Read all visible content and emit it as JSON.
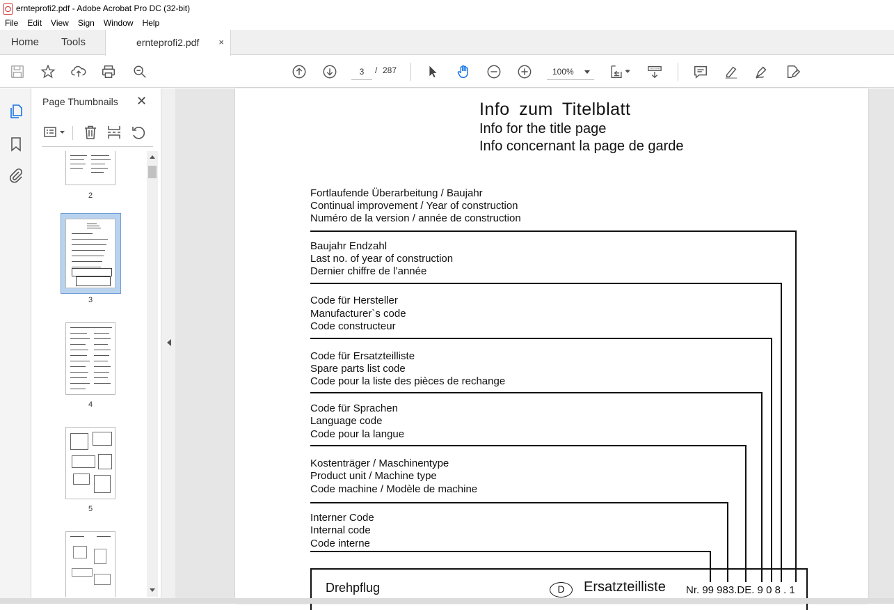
{
  "window": {
    "title": "ernteprofi2.pdf - Adobe Acrobat Pro DC (32-bit)"
  },
  "menu": [
    "File",
    "Edit",
    "View",
    "Sign",
    "Window",
    "Help"
  ],
  "tabs": {
    "home": "Home",
    "tools": "Tools",
    "document": "ernteprofi2.pdf",
    "close": "×"
  },
  "toolbar": {
    "current_page": "3",
    "page_separator": "/",
    "total_pages": "287",
    "zoom": "100%",
    "icons": [
      "save-icon",
      "star-icon",
      "upload-icon",
      "print-icon",
      "search-zoom-icon",
      "page-up-icon",
      "page-down-icon",
      "select-arrow-icon",
      "hand-icon",
      "zoom-out-icon",
      "zoom-in-icon",
      "fit-page-icon",
      "scroll-mode-icon",
      "comment-icon",
      "highlight-icon",
      "sign-icon",
      "edit-icon"
    ]
  },
  "sidebar": {
    "title": "Page Thumbnails",
    "close": "✕",
    "thumbnails": [
      {
        "num": "2"
      },
      {
        "num": "3",
        "selected": true
      },
      {
        "num": "4"
      },
      {
        "num": "5"
      }
    ]
  },
  "document": {
    "title_de": "Info  zum  Titelblatt",
    "title_en": "Info for the title page",
    "title_fr": "Info concernant la page de garde",
    "blocks": [
      [
        "Fortlaufende Überarbeitung / Baujahr",
        "Continual improvement / Year of construction",
        "Numéro de la version / année de construction"
      ],
      [
        "Baujahr Endzahl",
        "Last no. of year of construction",
        "Dernier chiffre de l’année"
      ],
      [
        "Code für Hersteller",
        "Manufacturer`s  code",
        "Code constructeur"
      ],
      [
        "Code für Ersatzteilliste",
        "Spare parts list code",
        "Code pour la liste des pièces de rechange"
      ],
      [
        "Code für Sprachen",
        "Language code",
        "Code pour la langue"
      ],
      [
        "Kostenträger / Maschinentype",
        "Product unit / Machine type",
        "Code machine / Modèle de machine"
      ],
      [
        "Interner Code",
        "Internal code",
        "Code interne"
      ]
    ],
    "box": {
      "left_label": "Drehpflug",
      "lang_badge": "D",
      "center_label": "Ersatzteilliste",
      "number": "Nr. 99 983.DE. 9 0 8 . 1"
    }
  }
}
